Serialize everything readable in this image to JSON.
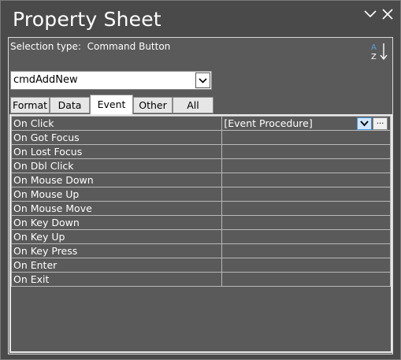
{
  "window": {
    "title": "Property Sheet"
  },
  "selection": {
    "label": "Selection type:  Command Button"
  },
  "object_combo": {
    "value": "cmdAddNew"
  },
  "tabs": [
    {
      "label": "Format",
      "active": false
    },
    {
      "label": "Data",
      "active": false
    },
    {
      "label": "Event",
      "active": true
    },
    {
      "label": "Other",
      "active": false
    },
    {
      "label": "All",
      "active": false
    }
  ],
  "properties": [
    {
      "name": "On Click",
      "value": "[Event Procedure]"
    },
    {
      "name": "On Got Focus",
      "value": ""
    },
    {
      "name": "On Lost Focus",
      "value": ""
    },
    {
      "name": "On Dbl Click",
      "value": ""
    },
    {
      "name": "On Mouse Down",
      "value": ""
    },
    {
      "name": "On Mouse Up",
      "value": ""
    },
    {
      "name": "On Mouse Move",
      "value": ""
    },
    {
      "name": "On Key Down",
      "value": ""
    },
    {
      "name": "On Key Up",
      "value": ""
    },
    {
      "name": "On Key Press",
      "value": ""
    },
    {
      "name": "On Enter",
      "value": ""
    },
    {
      "name": "On Exit",
      "value": ""
    }
  ],
  "build_button": {
    "label": "..."
  },
  "icons": {
    "collapse": "chevron-down-icon",
    "close": "close-icon",
    "sort": "sort-az-icon",
    "dropdown": "chevron-down-icon"
  },
  "colors": {
    "pane_bg": "#4a4a4a",
    "grid_bg": "#5a5a5a",
    "dropdown_highlight": "#cfe7fb"
  }
}
